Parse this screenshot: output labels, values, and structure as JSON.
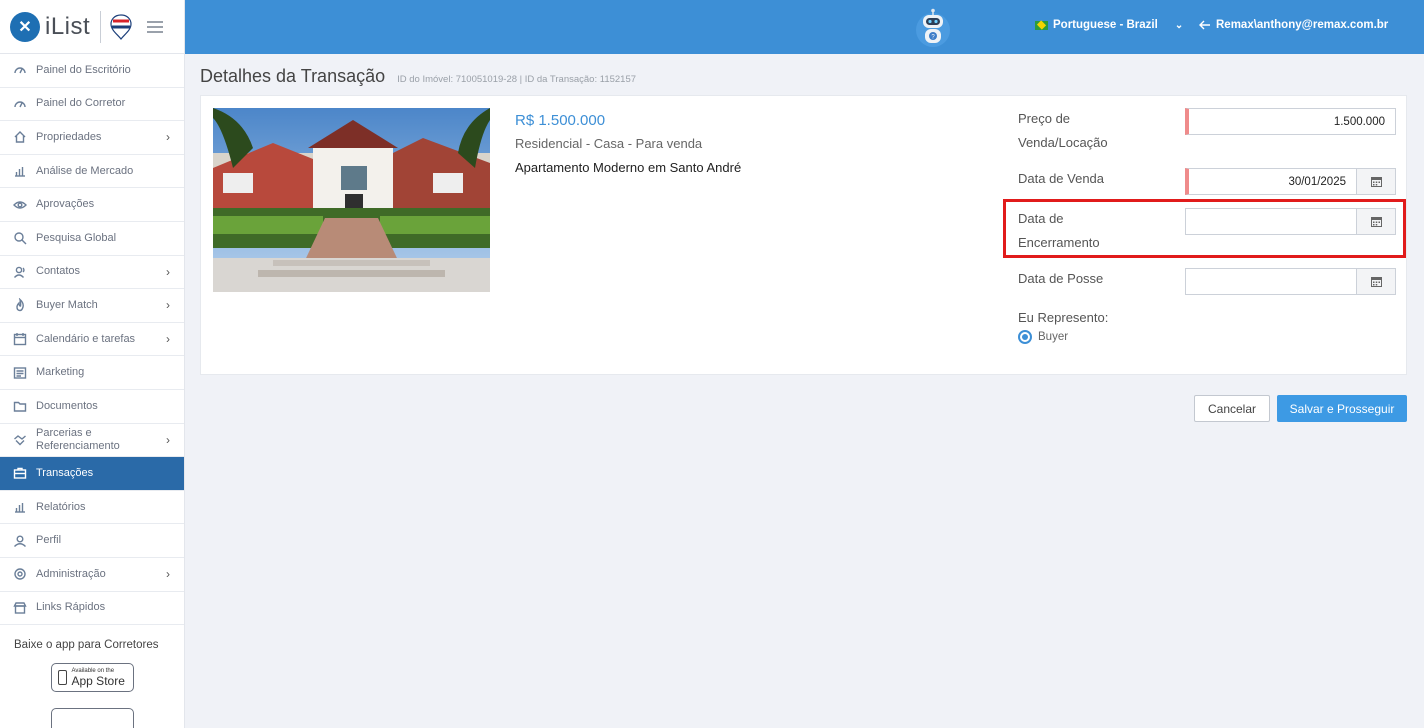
{
  "brand": {
    "name": "iList",
    "logo_letter": "✕",
    "remax_label": "RE/MAX"
  },
  "sidebar": {
    "items": [
      {
        "label": "Painel do Escritório",
        "icon": "gauge-icon",
        "has_children": false
      },
      {
        "label": "Painel do Corretor",
        "icon": "gauge-icon",
        "has_children": false
      },
      {
        "label": "Propriedades",
        "icon": "home-icon",
        "has_children": true
      },
      {
        "label": "Análise de Mercado",
        "icon": "bar-chart-icon",
        "has_children": false
      },
      {
        "label": "Aprovações",
        "icon": "eye-icon",
        "has_children": false
      },
      {
        "label": "Pesquisa Global",
        "icon": "search-icon",
        "has_children": false
      },
      {
        "label": "Contatos",
        "icon": "contacts-icon",
        "has_children": true
      },
      {
        "label": "Buyer Match",
        "icon": "flame-icon",
        "has_children": true
      },
      {
        "label": "Calendário e tarefas",
        "icon": "calendar-icon",
        "has_children": true
      },
      {
        "label": "Marketing",
        "icon": "newspaper-icon",
        "has_children": false
      },
      {
        "label": "Documentos",
        "icon": "folder-icon",
        "has_children": false
      },
      {
        "label": "Parcerias e Referenciamento",
        "icon": "handshake-icon",
        "has_children": true
      },
      {
        "label": "Transações",
        "icon": "briefcase-icon",
        "has_children": false,
        "active": true
      },
      {
        "label": "Relatórios",
        "icon": "bar-chart-icon",
        "has_children": false
      },
      {
        "label": "Perfil",
        "icon": "user-icon",
        "has_children": false
      },
      {
        "label": "Administração",
        "icon": "gear-icon",
        "has_children": true
      },
      {
        "label": "Links Rápidos",
        "icon": "store-icon",
        "has_children": false
      }
    ],
    "app_promo": "Baixe o app para Corretores",
    "app_store": {
      "small": "Available on the",
      "big": "App Store"
    }
  },
  "topbar": {
    "language": "Portuguese - Brazil",
    "user": "Remax\\anthony@remax.com.br"
  },
  "page": {
    "title": "Detalhes da Transação",
    "subtitle": "ID do Imóvel: 710051019-28 | ID da Transação: 1152157"
  },
  "property": {
    "price": "R$ 1.500.000",
    "type": "Residencial - Casa - Para venda",
    "name": "Apartamento Moderno em Santo André"
  },
  "form": {
    "price_label_1": "Preço de",
    "price_label_2": "Venda/Locação",
    "price_value": "1.500.000",
    "sale_date_label": "Data de Venda",
    "sale_date_value": "30/01/2025",
    "closing_date_label_1": "Data de",
    "closing_date_label_2": "Encerramento",
    "closing_date_value": "",
    "possession_date_label": "Data de Posse",
    "possession_date_value": "",
    "represent_label": "Eu Represento:",
    "represent_option": "Buyer"
  },
  "actions": {
    "cancel": "Cancelar",
    "save": "Salvar e Prosseguir"
  },
  "colors": {
    "topbar": "#3d8fd6",
    "active_nav": "#2a6aa8",
    "primary_button": "#3d9ae4",
    "highlight": "#e11b1b",
    "required_marker": "#ef8b8b"
  }
}
